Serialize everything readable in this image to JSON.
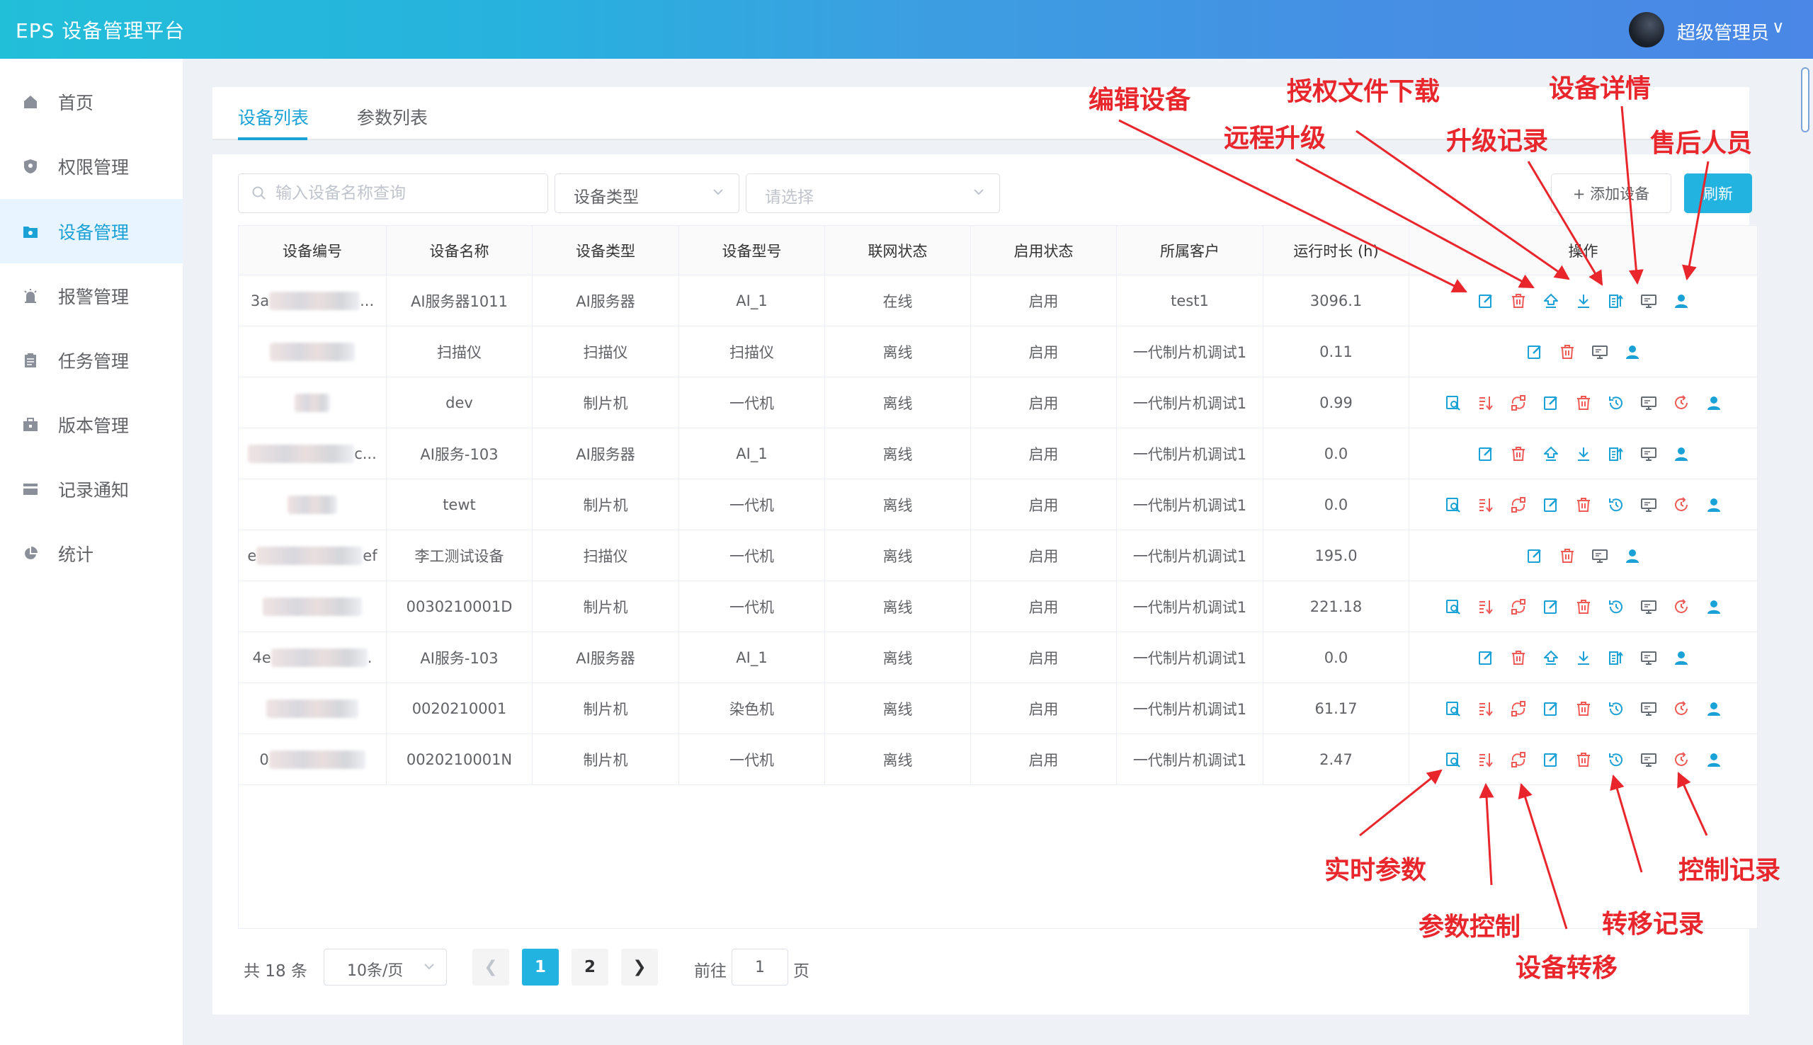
{
  "header": {
    "brand": "EPS 设备管理平台",
    "username": "超级管理员",
    "caret": "∨"
  },
  "sidebar": {
    "items": [
      {
        "label": "首页",
        "icon": "home-icon",
        "active": false
      },
      {
        "label": "权限管理",
        "icon": "shield-icon",
        "active": false
      },
      {
        "label": "设备管理",
        "icon": "device-folder-icon",
        "active": true
      },
      {
        "label": "报警管理",
        "icon": "alarm-icon",
        "active": false
      },
      {
        "label": "任务管理",
        "icon": "clipboard-icon",
        "active": false
      },
      {
        "label": "版本管理",
        "icon": "briefcase-icon",
        "active": false
      },
      {
        "label": "记录通知",
        "icon": "card-icon",
        "active": false
      },
      {
        "label": "统计",
        "icon": "pie-chart-icon",
        "active": false
      }
    ]
  },
  "tabs": [
    {
      "label": "设备列表",
      "active": true
    },
    {
      "label": "参数列表",
      "active": false
    }
  ],
  "filters": {
    "search_placeholder": "输入设备名称查询",
    "type_select": "设备类型",
    "value_select_placeholder": "请选择",
    "add_label": "+ 添加设备",
    "refresh_label": "刷新"
  },
  "table": {
    "columns": [
      "设备编号",
      "设备名称",
      "设备类型",
      "设备型号",
      "联网状态",
      "启用状态",
      "所属客户",
      "运行时长 (h)",
      "操作"
    ],
    "rows": [
      {
        "id_prefix": "3a",
        "id_suffix": "...",
        "name": "AI服务器1011",
        "type": "AI服务器",
        "model": "AI_1",
        "net": "在线",
        "enabled": "启用",
        "customer": "test1",
        "runtime": "3096.1",
        "ops": "ai"
      },
      {
        "id_prefix": "",
        "id_suffix": "",
        "name": "扫描仪",
        "type": "扫描仪",
        "model": "扫描仪",
        "net": "离线",
        "enabled": "启用",
        "customer": "一代制片机调试1",
        "runtime": "0.11",
        "ops": "scanner"
      },
      {
        "id_prefix": "",
        "id_suffix": "",
        "name": "dev",
        "type": "制片机",
        "model": "一代机",
        "net": "离线",
        "enabled": "启用",
        "customer": "一代制片机调试1",
        "runtime": "0.99",
        "ops": "maker"
      },
      {
        "id_prefix": "",
        "id_suffix": "c...",
        "name": "AI服务-103",
        "type": "AI服务器",
        "model": "AI_1",
        "net": "离线",
        "enabled": "启用",
        "customer": "一代制片机调试1",
        "runtime": "0.0",
        "ops": "ai"
      },
      {
        "id_prefix": "",
        "id_suffix": "",
        "name": "tewt",
        "type": "制片机",
        "model": "一代机",
        "net": "离线",
        "enabled": "启用",
        "customer": "一代制片机调试1",
        "runtime": "0.0",
        "ops": "maker"
      },
      {
        "id_prefix": "e",
        "id_suffix": "ef",
        "name": "李工测试设备",
        "type": "扫描仪",
        "model": "一代机",
        "net": "离线",
        "enabled": "启用",
        "customer": "一代制片机调试1",
        "runtime": "195.0",
        "ops": "scanner"
      },
      {
        "id_prefix": "",
        "id_suffix": "",
        "name": "0030210001D",
        "type": "制片机",
        "model": "一代机",
        "net": "离线",
        "enabled": "启用",
        "customer": "一代制片机调试1",
        "runtime": "221.18",
        "ops": "maker"
      },
      {
        "id_prefix": "4e",
        "id_suffix": ".",
        "name": "AI服务-103",
        "type": "AI服务器",
        "model": "AI_1",
        "net": "离线",
        "enabled": "启用",
        "customer": "一代制片机调试1",
        "runtime": "0.0",
        "ops": "ai"
      },
      {
        "id_prefix": "",
        "id_suffix": "",
        "name": "0020210001",
        "type": "制片机",
        "model": "染色机",
        "net": "离线",
        "enabled": "启用",
        "customer": "一代制片机调试1",
        "runtime": "61.17",
        "ops": "maker"
      },
      {
        "id_prefix": "0",
        "id_suffix": "",
        "name": "0020210001N",
        "type": "制片机",
        "model": "一代机",
        "net": "离线",
        "enabled": "启用",
        "customer": "一代制片机调试1",
        "runtime": "2.47",
        "ops": "maker"
      }
    ]
  },
  "pagination": {
    "total_label": "共 18 条",
    "page_size": "10条/页",
    "pages": [
      "1",
      "2"
    ],
    "current": "1",
    "goto_prefix": "前往",
    "goto_value": "1",
    "goto_suffix": "页"
  },
  "annotations": {
    "edit_device": "编辑设备",
    "remote_upgrade": "远程升级",
    "license_download": "授权文件下载",
    "upgrade_record": "升级记录",
    "device_detail": "设备详情",
    "after_sales": "售后人员",
    "realtime_params": "实时参数",
    "param_control": "参数控制",
    "device_transfer": "设备转移",
    "transfer_record": "转移记录",
    "control_record": "控制记录"
  },
  "colors": {
    "accent": "#1aa1d6",
    "danger": "#f05a55",
    "annotation": "#e8262b"
  }
}
